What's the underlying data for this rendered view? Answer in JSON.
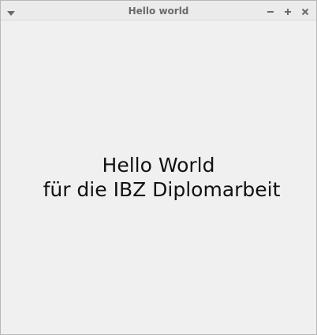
{
  "window": {
    "title": "Hello world",
    "controls": {
      "menu_icon": "chevron-down-icon",
      "minimize_icon": "minus-icon",
      "maximize_icon": "plus-icon",
      "close_icon": "close-icon"
    }
  },
  "content": {
    "line1": "Hello World",
    "line2": "für die IBZ Diplomarbeit"
  },
  "colors": {
    "background": "#f0f0f0",
    "titlebar": "#ebebeb",
    "title_text": "#6a6a6a",
    "text": "#111111"
  }
}
